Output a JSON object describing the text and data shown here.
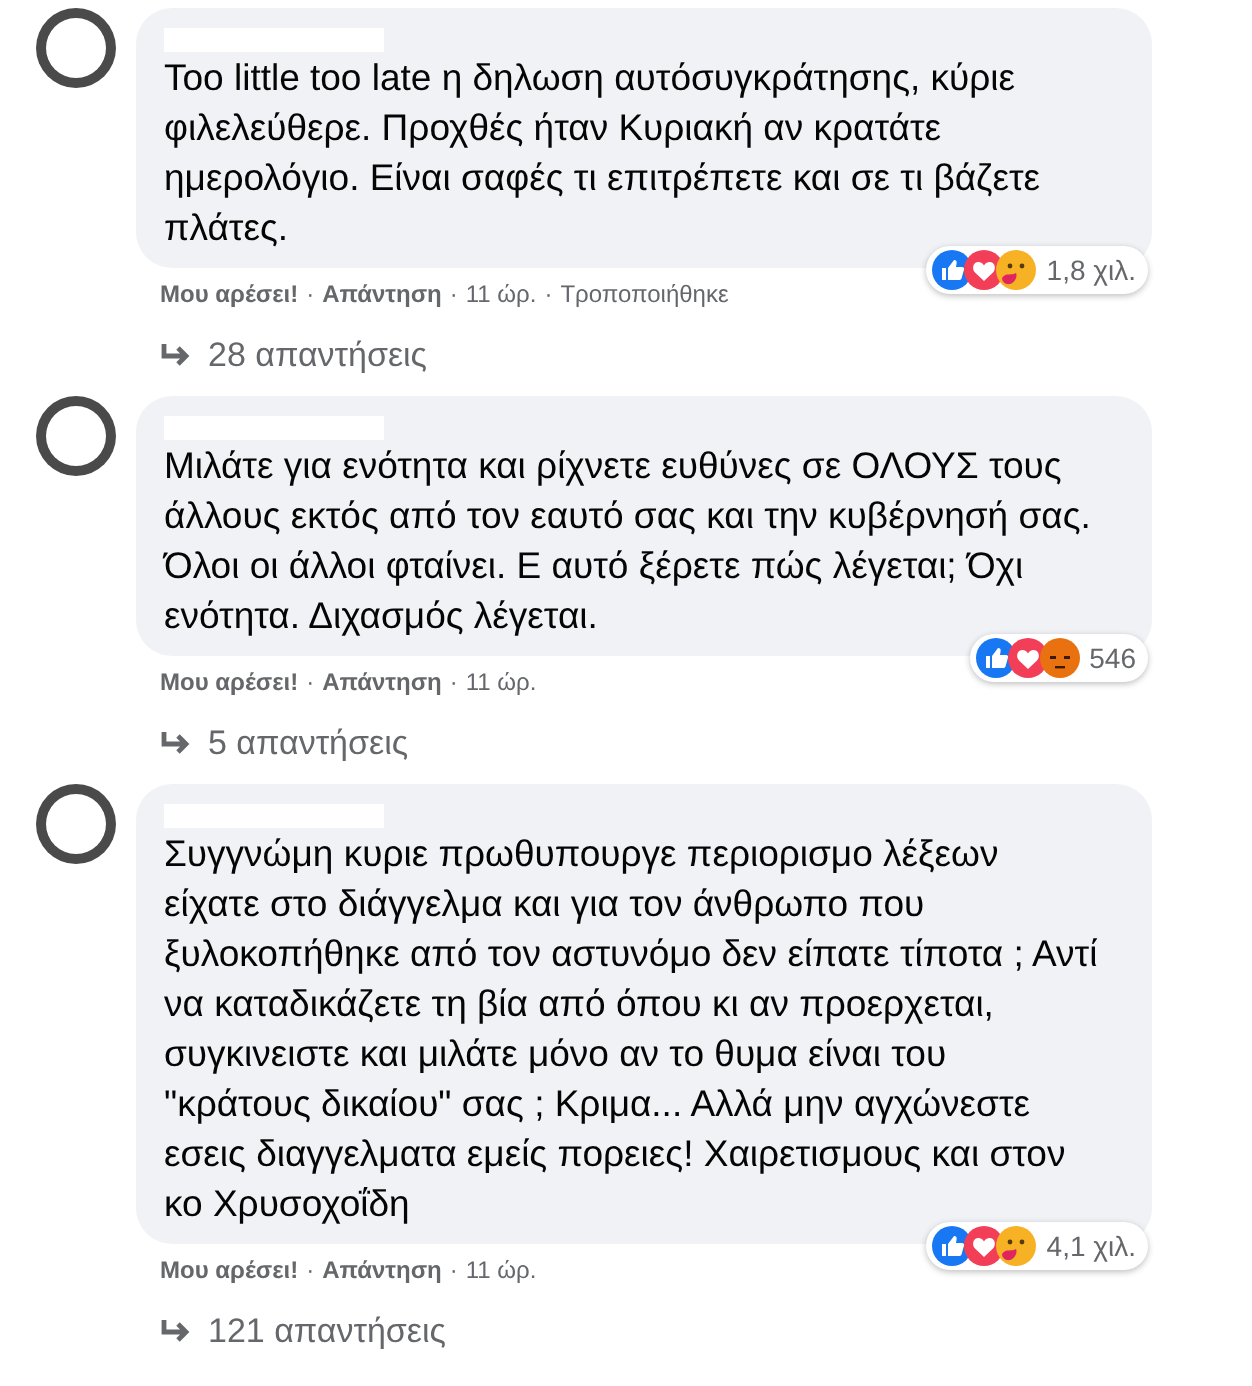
{
  "comments": [
    {
      "text": "Too little too late η δηλωση αυτόσυγκράτησης, κύριε φιλελεύθερε. Προχθές ήταν Κυριακή αν κρατάτε ημερολόγιο. Είναι σαφές τι επιτρέπετε και σε τι βάζετε πλάτες.",
      "reactions": [
        {
          "kind": "like"
        },
        {
          "kind": "love"
        },
        {
          "kind": "care"
        }
      ],
      "reaction_count": "1,8 χιλ.",
      "separator": "·",
      "like": "Μου αρέσει!",
      "reply": "Απάντηση",
      "time": "11 ώρ.",
      "edited": "Τροποποιήθηκε",
      "replies": "28 απαντήσεις"
    },
    {
      "text": "Μιλάτε για ενότητα και ρίχνετε ευθύνες σε ΟΛΟΥΣ τους άλλους εκτός από τον εαυτό σας και την κυβέρνησή σας. Όλοι οι άλλοι φταίνει. Ε αυτό ξέρετε πώς λέγεται; Όχι ενότητα. Διχασμός λέγεται.",
      "reactions": [
        {
          "kind": "like"
        },
        {
          "kind": "love"
        },
        {
          "kind": "angry"
        }
      ],
      "reaction_count": "546",
      "separator": "·",
      "like": "Μου αρέσει!",
      "reply": "Απάντηση",
      "time": "11 ώρ.",
      "replies": "5 απαντήσεις"
    },
    {
      "text": "Συγγνώμη κυριε πρωθυπουργε περιορισμο λέξεων είχατε στο διάγγελμα και για τον άνθρωπο που ξυλοκοπήθηκε από τον αστυνόμο δεν είπατε τίποτα ; Αντί να καταδικάζετε τη βία από όπου κι αν προερχεται, συγκινειστε και μιλάτε μόνο αν το θυμα είναι του \"κράτους δικαίου\" σας ; Κριμα... Αλλά μην αγχώνεστε εσεις διαγγελματα εμείς πορειες! Χαιρετισμους και στον κο Χρυσοχοΐδη",
      "reactions": [
        {
          "kind": "like"
        },
        {
          "kind": "love"
        },
        {
          "kind": "care"
        }
      ],
      "reaction_count": "4,1 χιλ.",
      "separator": "·",
      "like": "Μου αρέσει!",
      "reply": "Απάντηση",
      "time": "11 ώρ.",
      "replies": "121 απαντήσεις"
    }
  ]
}
